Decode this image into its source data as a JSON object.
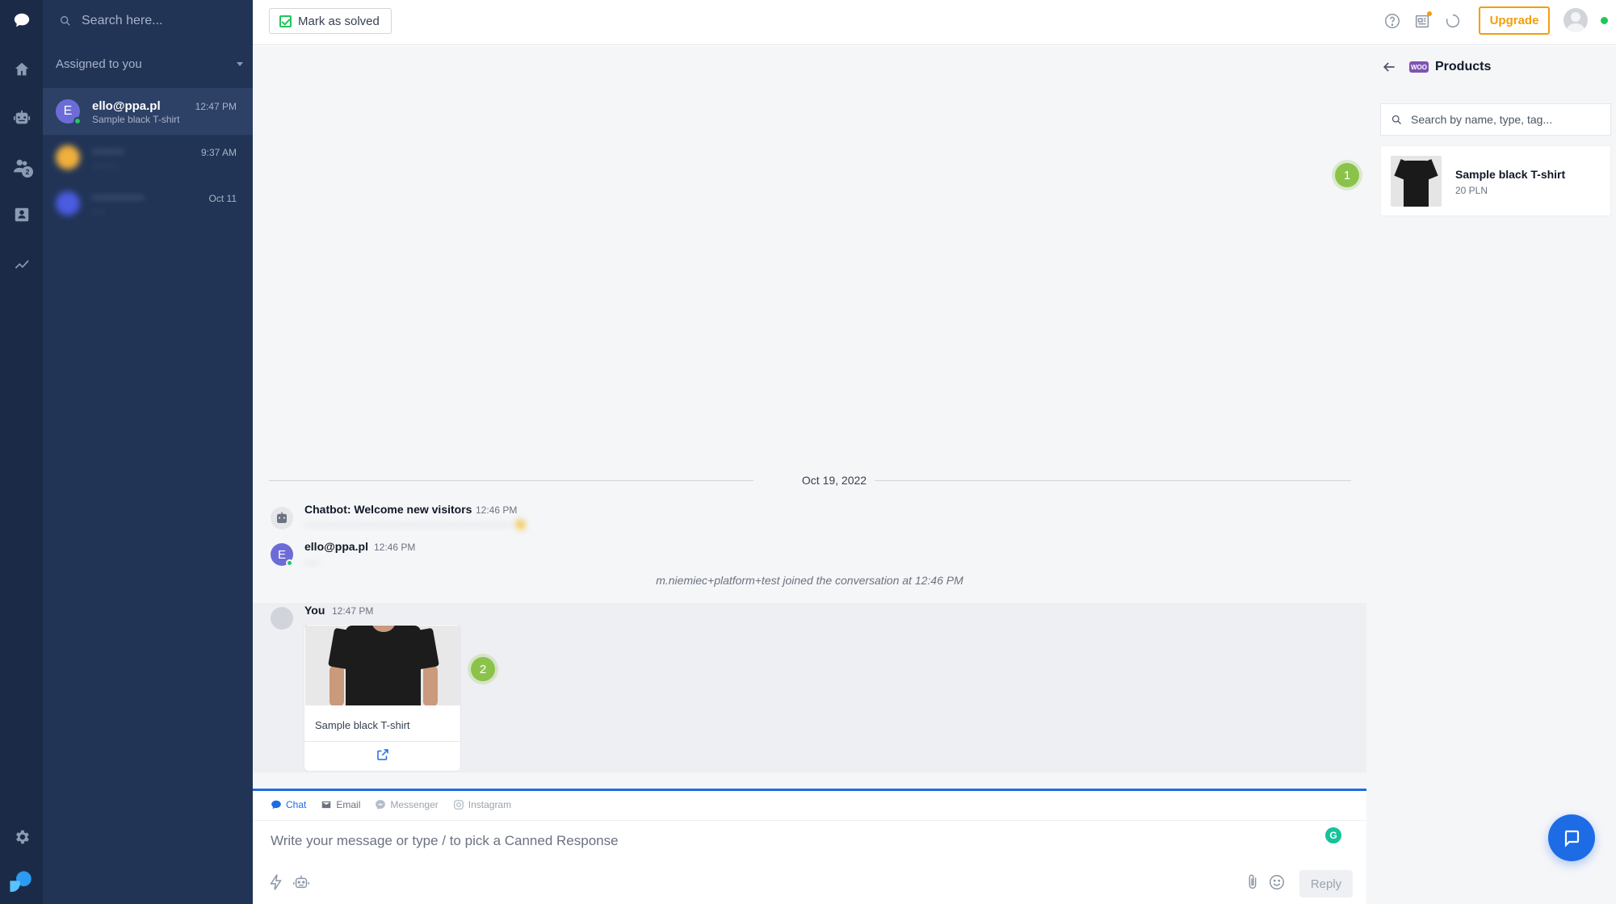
{
  "sidebar": {
    "badge_count": "2"
  },
  "conversations": {
    "search_placeholder": "Search here...",
    "filter_label": "Assigned to you",
    "items": [
      {
        "initial": "E",
        "name": "ello@ppa.pl",
        "preview": "Sample black T-shirt",
        "time": "12:47 PM"
      },
      {
        "initial": "",
        "name": "········",
        "preview": "········",
        "time": "9:37 AM"
      },
      {
        "initial": "",
        "name": "·············",
        "preview": "····",
        "time": "Oct 11"
      }
    ]
  },
  "topbar": {
    "mark_solved_label": "Mark as solved",
    "upgrade_label": "Upgrade"
  },
  "chat": {
    "date_label": "Oct 19, 2022",
    "messages": [
      {
        "author": "Chatbot: Welcome new visitors",
        "time": "12:46 PM",
        "text": "··························································· 👋"
      },
      {
        "author": "ello@ppa.pl",
        "initial": "E",
        "time": "12:46 PM",
        "text": "····"
      },
      {
        "system": "m.niemiec+platform+test joined the conversation at 12:46 PM"
      },
      {
        "author": "You",
        "time": "12:47 PM",
        "product_title": "Sample black T-shirt"
      }
    ],
    "step_badges": [
      "1",
      "2"
    ]
  },
  "composer": {
    "tabs": [
      "Chat",
      "Email",
      "Messenger",
      "Instagram"
    ],
    "placeholder": "Write your message or type / to pick a Canned Response",
    "reply_label": "Reply"
  },
  "products_panel": {
    "title": "Products",
    "woo_label": "WOO",
    "search_placeholder": "Search by name, type, tag...",
    "items": [
      {
        "name": "Sample black T-shirt",
        "price": "20 PLN"
      }
    ]
  },
  "colors": {
    "accent": "#1e6be6",
    "upgrade": "#f59e0b",
    "online": "#22c55e",
    "step_badge": "#8bc34a",
    "rail_bg": "#1b2b47",
    "list_bg": "#213456"
  }
}
